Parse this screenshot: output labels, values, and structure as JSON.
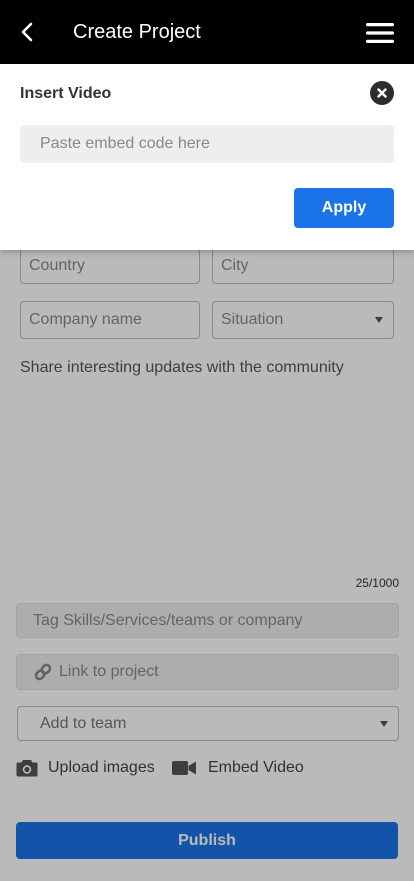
{
  "header": {
    "title": "Create Project"
  },
  "form": {
    "country_placeholder": "Country",
    "city_placeholder": "City",
    "company_placeholder": "Company name",
    "situation_placeholder": "Situation",
    "share_text": "Share interesting updates with the community",
    "counter": "25/1000",
    "tag_placeholder": "Tag Skills/Services/teams or company",
    "link_label": "Link to project",
    "team_select": "Add to team",
    "upload_label": "Upload images",
    "embed_label": "Embed Video",
    "publish_label": "Publish"
  },
  "modal": {
    "title": "Insert Video",
    "embed_placeholder": "Paste embed code here",
    "apply_label": "Apply"
  },
  "icons": {
    "back": "back-arrow-icon",
    "menu": "hamburger-menu-icon",
    "close": "close-icon",
    "link": "link-icon",
    "camera": "camera-icon",
    "video": "video-camera-icon"
  },
  "colors": {
    "header_bg": "#000000",
    "accent": "#1a73e8",
    "overlay": "rgba(0,0,0,0.27)"
  }
}
